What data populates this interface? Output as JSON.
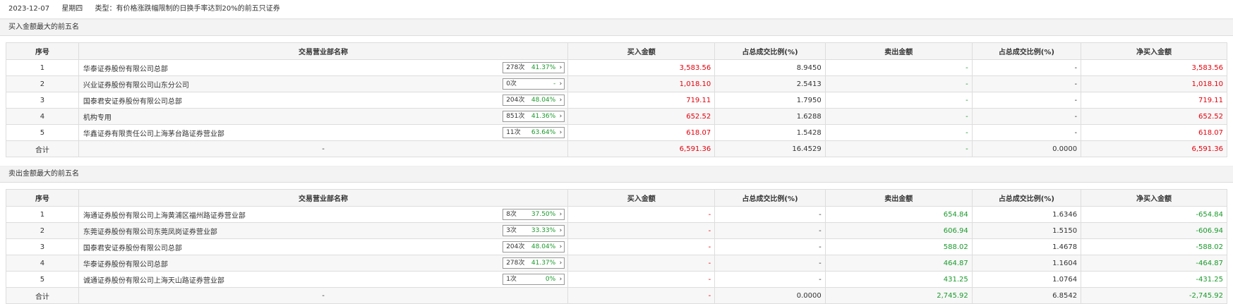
{
  "header": {
    "date": "2023-12-07",
    "weekday": "星期四",
    "type_label": "类型：有价格涨跌幅限制的日换手率达到20%的前五只证券"
  },
  "columns": [
    "序号",
    "交易营业部名称",
    "买入金额",
    "占总成交比例(%)",
    "卖出金额",
    "占总成交比例(%)",
    "净买入金额"
  ],
  "buy_section": {
    "title": "买入金额最大的前五名",
    "rows": [
      {
        "no": "1",
        "name": "华泰证券股份有限公司总部",
        "times": "278次",
        "pct": "41.37%",
        "buy": "3,583.56",
        "buy_ratio": "8.9450",
        "sell": "-",
        "sell_ratio": "-",
        "net": "3,583.56"
      },
      {
        "no": "2",
        "name": "兴业证券股份有限公司山东分公司",
        "times": "0次",
        "pct": "-",
        "buy": "1,018.10",
        "buy_ratio": "2.5413",
        "sell": "-",
        "sell_ratio": "-",
        "net": "1,018.10"
      },
      {
        "no": "3",
        "name": "国泰君安证券股份有限公司总部",
        "times": "204次",
        "pct": "48.04%",
        "buy": "719.11",
        "buy_ratio": "1.7950",
        "sell": "-",
        "sell_ratio": "-",
        "net": "719.11"
      },
      {
        "no": "4",
        "name": "机构专用",
        "times": "851次",
        "pct": "41.36%",
        "buy": "652.52",
        "buy_ratio": "1.6288",
        "sell": "-",
        "sell_ratio": "-",
        "net": "652.52"
      },
      {
        "no": "5",
        "name": "华鑫证券有限责任公司上海茅台路证券营业部",
        "times": "11次",
        "pct": "63.64%",
        "buy": "618.07",
        "buy_ratio": "1.5428",
        "sell": "-",
        "sell_ratio": "-",
        "net": "618.07"
      }
    ],
    "total": {
      "label": "合计",
      "name": "-",
      "buy": "6,591.36",
      "buy_ratio": "16.4529",
      "sell": "-",
      "sell_ratio": "0.0000",
      "net": "6,591.36"
    }
  },
  "sell_section": {
    "title": "卖出金额最大的前五名",
    "rows": [
      {
        "no": "1",
        "name": "海通证券股份有限公司上海黄浦区福州路证券营业部",
        "times": "8次",
        "pct": "37.50%",
        "buy": "-",
        "buy_ratio": "-",
        "sell": "654.84",
        "sell_ratio": "1.6346",
        "net": "-654.84"
      },
      {
        "no": "2",
        "name": "东莞证券股份有限公司东莞凤岗证券营业部",
        "times": "3次",
        "pct": "33.33%",
        "buy": "-",
        "buy_ratio": "-",
        "sell": "606.94",
        "sell_ratio": "1.5150",
        "net": "-606.94"
      },
      {
        "no": "3",
        "name": "国泰君安证券股份有限公司总部",
        "times": "204次",
        "pct": "48.04%",
        "buy": "-",
        "buy_ratio": "-",
        "sell": "588.02",
        "sell_ratio": "1.4678",
        "net": "-588.02"
      },
      {
        "no": "4",
        "name": "华泰证券股份有限公司总部",
        "times": "278次",
        "pct": "41.37%",
        "buy": "-",
        "buy_ratio": "-",
        "sell": "464.87",
        "sell_ratio": "1.1604",
        "net": "-464.87"
      },
      {
        "no": "5",
        "name": "诚通证券股份有限公司上海天山路证券营业部",
        "times": "1次",
        "pct": "0%",
        "buy": "-",
        "buy_ratio": "-",
        "sell": "431.25",
        "sell_ratio": "1.0764",
        "net": "-431.25"
      }
    ],
    "total": {
      "label": "合计",
      "name": "-",
      "buy": "-",
      "buy_ratio": "0.0000",
      "sell": "2,745.92",
      "sell_ratio": "6.8542",
      "net": "-2,745.92"
    }
  },
  "icons": {
    "arrow": "chevron-right-icon"
  },
  "colors": {
    "positive": "#e4000b",
    "negative": "#1a9a2b"
  }
}
